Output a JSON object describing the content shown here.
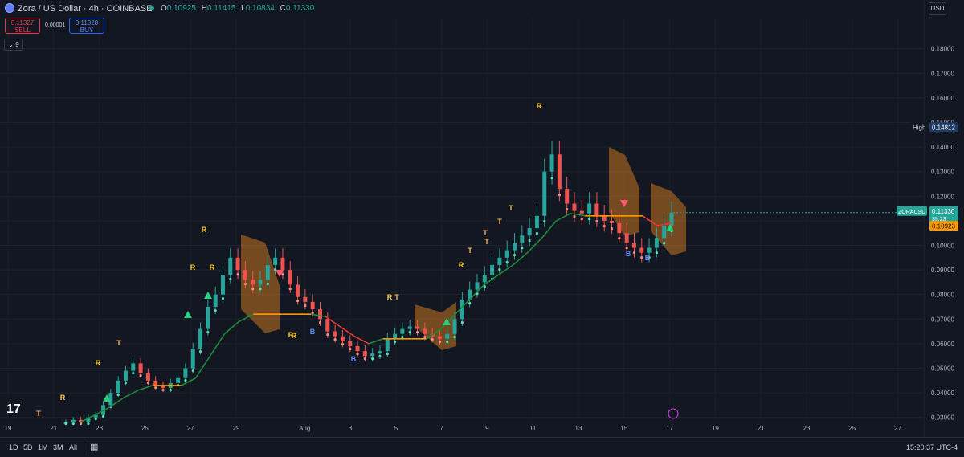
{
  "header": {
    "symbol_title": "Zora / US Dollar · 4h · COINBASE",
    "ohlc": {
      "o_label": "O",
      "o": "0.10925",
      "h_label": "H",
      "h": "0.11415",
      "l_label": "L",
      "l": "0.10834",
      "c_label": "C",
      "c": "0.11330"
    },
    "sell_price": "0.11327",
    "sell_label": "SELL",
    "spread": "0.00001",
    "buy_price": "0.11328",
    "buy_label": "BUY",
    "indicator_toggle": "9",
    "currency": "USD"
  },
  "footer": {
    "ranges": [
      "1D",
      "5D",
      "1M",
      "3M",
      "All"
    ],
    "clock": "15:20:37 UTC-4"
  },
  "colors": {
    "up": "#26a69a",
    "down": "#ef5350",
    "highlight": "#ffcc33",
    "trail_up": "#1b8a3a",
    "trail_down": "#e53935",
    "box": "#c8741f"
  },
  "chart_data": {
    "type": "candlestick",
    "ylim": [
      0.025,
      0.185
    ],
    "y_ticks": [
      "0.18000",
      "0.17000",
      "0.16000",
      "0.15000",
      "0.14000",
      "0.13000",
      "0.12000",
      "0.11000",
      "0.10000",
      "0.09000",
      "0.08000",
      "0.07000",
      "0.06000",
      "0.05000",
      "0.04000",
      "0.03000"
    ],
    "x_tick_labels": [
      "19",
      "21",
      "23",
      "25",
      "27",
      "29",
      "Aug",
      "3",
      "5",
      "7",
      "9",
      "11",
      "13",
      "15",
      "17",
      "19",
      "21",
      "23",
      "25",
      "27"
    ],
    "x_tick_day_index": [
      0,
      2,
      4,
      6,
      8,
      10,
      13,
      15,
      17,
      19,
      21,
      23,
      25,
      27,
      29,
      31,
      33,
      35,
      37,
      39
    ],
    "symbol_label": "ZORAUSD",
    "last_price": "0.11330",
    "countdown": "39:23",
    "trail_price": "0.10923",
    "high_label": "High",
    "high_value": "0.14812",
    "closes_approx": [
      0.028,
      0.029,
      0.028,
      0.03,
      0.031,
      0.035,
      0.04,
      0.045,
      0.049,
      0.052,
      0.048,
      0.045,
      0.043,
      0.042,
      0.044,
      0.046,
      0.05,
      0.058,
      0.066,
      0.075,
      0.08,
      0.088,
      0.095,
      0.09,
      0.086,
      0.084,
      0.086,
      0.092,
      0.095,
      0.09,
      0.084,
      0.079,
      0.077,
      0.074,
      0.07,
      0.065,
      0.063,
      0.061,
      0.059,
      0.057,
      0.055,
      0.056,
      0.057,
      0.062,
      0.064,
      0.066,
      0.067,
      0.066,
      0.064,
      0.063,
      0.062,
      0.064,
      0.07,
      0.078,
      0.082,
      0.085,
      0.088,
      0.092,
      0.095,
      0.098,
      0.101,
      0.104,
      0.107,
      0.112,
      0.13,
      0.137,
      0.123,
      0.117,
      0.114,
      0.113,
      0.117,
      0.112,
      0.11,
      0.109,
      0.105,
      0.101,
      0.099,
      0.097,
      0.099,
      0.103,
      0.108,
      0.1133
    ],
    "trail_approx": [
      0.028,
      0.031,
      0.034,
      0.038,
      0.041,
      0.043,
      0.043,
      0.043,
      0.046,
      0.055,
      0.064,
      0.069,
      0.072,
      0.072,
      0.072,
      0.072,
      0.072,
      0.071,
      0.067,
      0.063,
      0.06,
      0.062,
      0.062,
      0.062,
      0.062,
      0.066,
      0.072,
      0.078,
      0.084,
      0.088,
      0.092,
      0.097,
      0.103,
      0.11,
      0.113,
      0.112,
      0.112,
      0.112,
      0.112,
      0.112,
      0.108,
      0.109
    ],
    "signal_letters": [
      "T",
      "R",
      "T",
      "R",
      "R",
      "R",
      "R",
      "R",
      "R",
      "B",
      "R",
      "T",
      "B",
      "R",
      "T",
      "T",
      "T",
      "T",
      "T",
      "R",
      "B",
      "B"
    ],
    "markers_up": 5,
    "markers_down": 2
  }
}
